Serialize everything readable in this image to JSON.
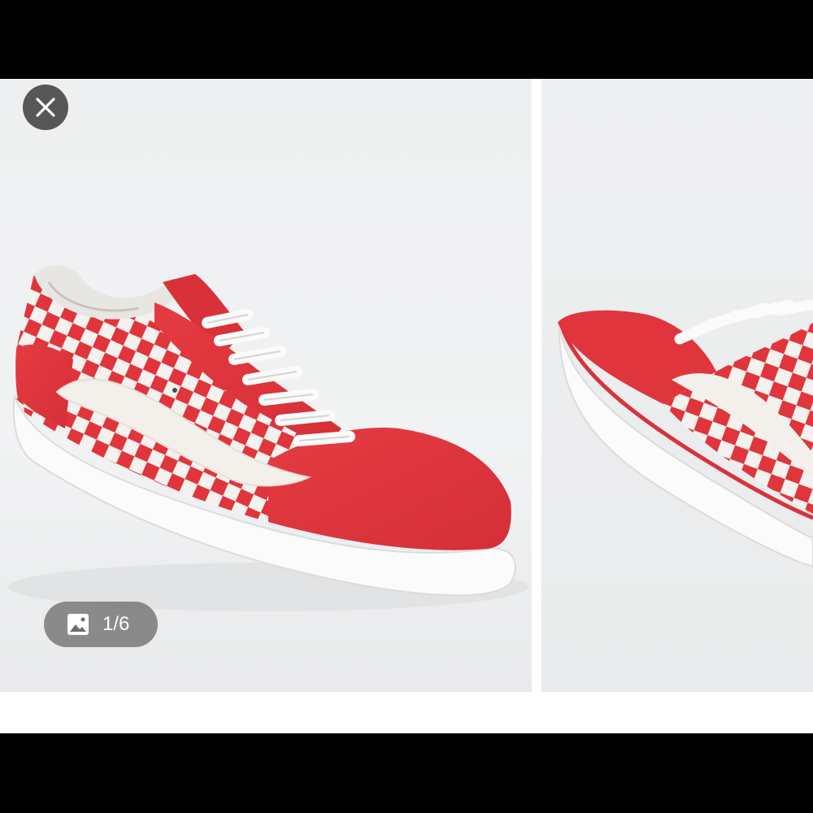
{
  "viewer": {
    "close_icon": "close-icon",
    "image_icon": "image-icon",
    "counter": "1/6",
    "current_index": 1,
    "total_images": 6
  },
  "colors": {
    "shoe_red": "#e0353c",
    "backdrop": "#eff0f1",
    "overlay": "#3c3c3c"
  }
}
